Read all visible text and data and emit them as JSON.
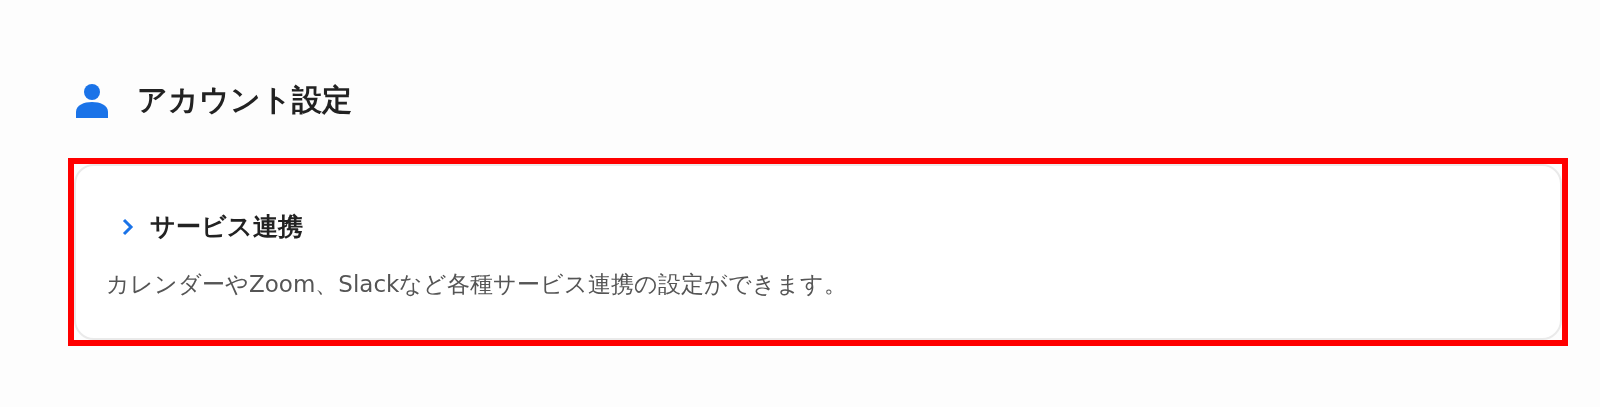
{
  "heading": {
    "title": "アカウント設定"
  },
  "items": [
    {
      "title": "サービス連携",
      "description": "カレンダーやZoom、Slackなど各種サービス連携の設定ができます。",
      "highlighted": true
    }
  ]
}
